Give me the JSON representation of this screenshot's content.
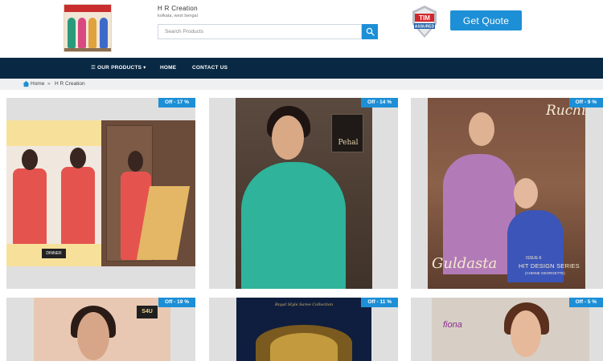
{
  "header": {
    "company_name": "H R Creation",
    "company_location": "kolkata, west bengal",
    "search_placeholder": "Search Products",
    "badge_line1": "TIM",
    "badge_line2": "ASSURED",
    "quote_label": "Get Quote"
  },
  "nav": {
    "products_label": "☰ OUR PRODUCTS ▾",
    "home_label": "HOME",
    "contact_label": "CONTACT US"
  },
  "breadcrumb": {
    "home": "Home",
    "separator": "»",
    "current": "H R Creation"
  },
  "products": [
    {
      "discount": "Off - 17 %",
      "brand_text": "DINNER"
    },
    {
      "discount": "Off - 14 %",
      "brand_text": "Pehal"
    },
    {
      "discount": "Off - 9 %",
      "brand_text": "Ruchi",
      "title": "Guldasta",
      "issue": "ISSUE-6",
      "series": "HIT DESIGN SERIES",
      "sub": "(CHINNE GEORGETTE)"
    },
    {
      "discount": "Off - 19 %",
      "brand_text": "S4U"
    },
    {
      "discount": "Off - 11 %",
      "caption": "Royal Style Saree Collection"
    },
    {
      "discount": "Off - 5 %",
      "brand_text": "fiona"
    }
  ],
  "colors": {
    "accent": "#1d8fd6",
    "nav_bg": "#082843",
    "breadcrumb_bg": "#eef0f1"
  }
}
